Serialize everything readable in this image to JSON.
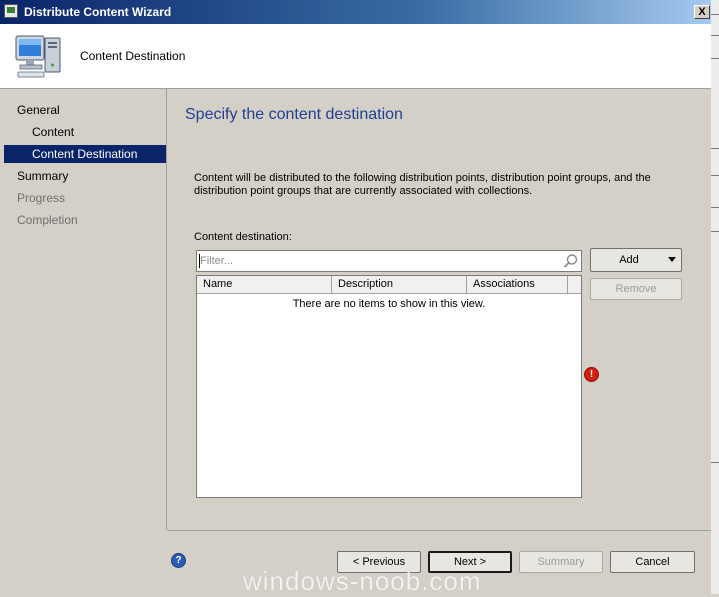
{
  "window": {
    "title": "Distribute Content Wizard",
    "close_label": "X"
  },
  "header": {
    "page_title": "Content Destination",
    "icon": "computer-icon"
  },
  "nav": {
    "items": [
      {
        "label": "General"
      },
      {
        "label": "Content"
      },
      {
        "label": "Content Destination"
      },
      {
        "label": "Summary"
      },
      {
        "label": "Progress"
      },
      {
        "label": "Completion"
      }
    ]
  },
  "main": {
    "heading": "Specify the content destination",
    "description": "Content will be distributed to the following distribution points, distribution point groups, and the distribution point groups that are currently associated with collections.",
    "destination_label": "Content destination:",
    "filter_placeholder": "Filter...",
    "columns": [
      "Name",
      "Description",
      "Associations"
    ],
    "empty_message": "There are no items to show in this view.",
    "add_label": "Add",
    "remove_label": "Remove",
    "error_icon": "error-icon"
  },
  "footer": {
    "help_icon": "help-icon",
    "help_glyph": "?",
    "previous_label": "< Previous",
    "next_label": "Next >",
    "summary_label": "Summary",
    "cancel_label": "Cancel"
  },
  "watermark": "windows-noob.com",
  "colors": {
    "titlebar_start": "#0a246a",
    "selection": "#0a246a",
    "heading": "#1f3f8f",
    "error": "#d21f0f"
  }
}
